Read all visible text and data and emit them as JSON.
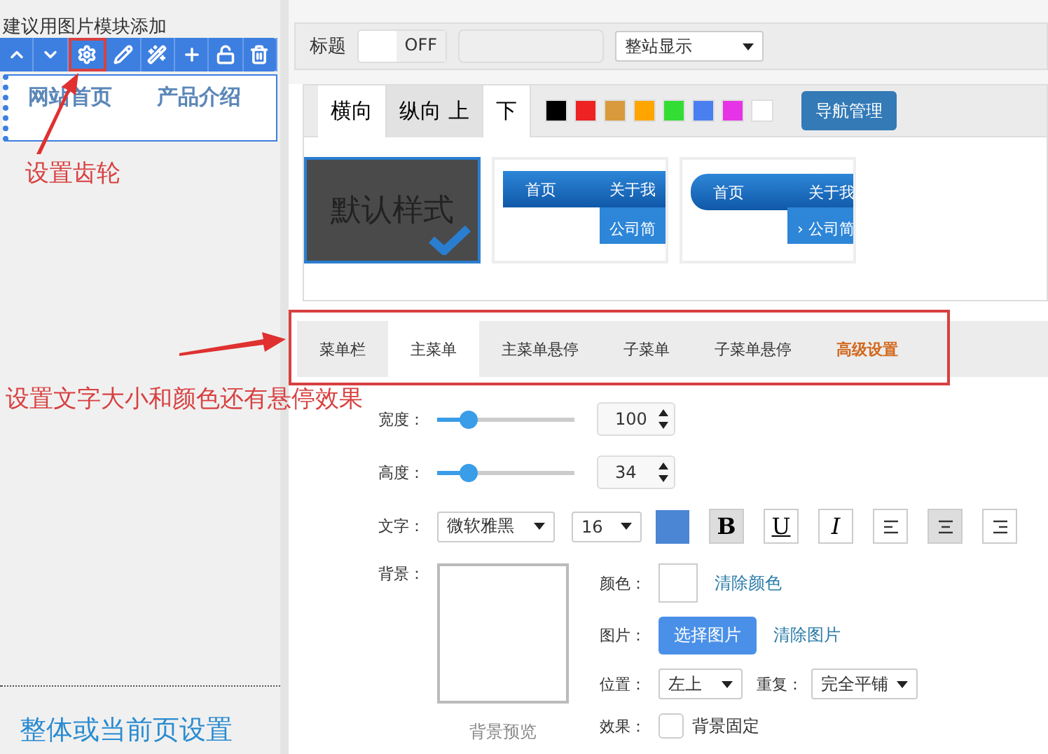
{
  "sidebar": {
    "hint": "建议用图片模块添加",
    "toolbar": [
      {
        "kind": "up",
        "highlighted": false
      },
      {
        "kind": "down",
        "highlighted": false
      },
      {
        "kind": "gear",
        "highlighted": true
      },
      {
        "kind": "pencil",
        "highlighted": false
      },
      {
        "kind": "wand",
        "highlighted": false
      },
      {
        "kind": "plus",
        "highlighted": false
      },
      {
        "kind": "unlock",
        "highlighted": false
      },
      {
        "kind": "trash",
        "highlighted": false
      }
    ],
    "nav_items": [
      "网站首页",
      "产品介绍"
    ],
    "footer_title": "整体或当前页设置"
  },
  "annotations": [
    {
      "text": "设置齿轮"
    },
    {
      "text": "设置文字大小和颜色还有悬停效果"
    }
  ],
  "title_row": {
    "label": "标题",
    "toggle": {
      "on": false,
      "label": "OFF"
    },
    "scope_select": "整站显示"
  },
  "layout_tabs": [
    {
      "label": "横向",
      "selected": true
    },
    {
      "label": "纵向 上",
      "selected": false
    },
    {
      "label": "下",
      "selected": true
    }
  ],
  "swatches": [
    {
      "color": "#000000"
    },
    {
      "color": "#ee2222"
    },
    {
      "color": "#d89a3c"
    },
    {
      "color": "#ffa500"
    },
    {
      "color": "#33dd33"
    },
    {
      "color": "#4a7ff0"
    },
    {
      "color": "#e633e6"
    },
    {
      "color": "#ffffff"
    }
  ],
  "nav_manage_button": "导航管理",
  "styles": [
    {
      "kind": "default",
      "label": "默认样式",
      "selected": true
    },
    {
      "kind": "flat",
      "items": [
        "首页",
        "关于我",
        "公司简"
      ],
      "selected": false
    },
    {
      "kind": "rounded",
      "items": [
        "首页",
        "关于我",
        "公司简"
      ],
      "arrow": "›",
      "selected": false
    }
  ],
  "menu_tabs": [
    {
      "label": "菜单栏",
      "kind": "normal",
      "selected": false
    },
    {
      "label": "主菜单",
      "kind": "normal",
      "selected": true
    },
    {
      "label": "主菜单悬停",
      "kind": "normal",
      "selected": false
    },
    {
      "label": "子菜单",
      "kind": "normal",
      "selected": false
    },
    {
      "label": "子菜单悬停",
      "kind": "normal",
      "selected": false
    },
    {
      "label": "高级设置",
      "kind": "advanced",
      "selected": false
    }
  ],
  "sliders": [
    {
      "label": "宽度：",
      "level": 0.22,
      "value": "100"
    },
    {
      "label": "高度：",
      "level": 0.22,
      "value": "34"
    }
  ],
  "text_row": {
    "label": "文字：",
    "font": "微软雅黑",
    "size": "16",
    "color": "#4a86d4",
    "buttons": [
      {
        "kind": "bold",
        "glyph": "B",
        "on": true
      },
      {
        "kind": "underline",
        "glyph": "U",
        "on": false
      },
      {
        "kind": "italic",
        "glyph": "I",
        "on": false
      },
      {
        "kind": "align-left",
        "on": false
      },
      {
        "kind": "align-center",
        "on": true
      },
      {
        "kind": "align-right",
        "on": false
      }
    ]
  },
  "background": {
    "label": "背景：",
    "preview_caption": "背景预览",
    "color_label": "颜色：",
    "clear_color": "清除颜色",
    "image_label": "图片：",
    "choose_image": "选择图片",
    "clear_image": "清除图片",
    "position_label": "位置：",
    "position": "左上",
    "repeat_label": "重复：",
    "repeat": "完全平铺",
    "effect_label": "效果：",
    "fixed": {
      "label": "背景固定",
      "checked": false
    }
  }
}
